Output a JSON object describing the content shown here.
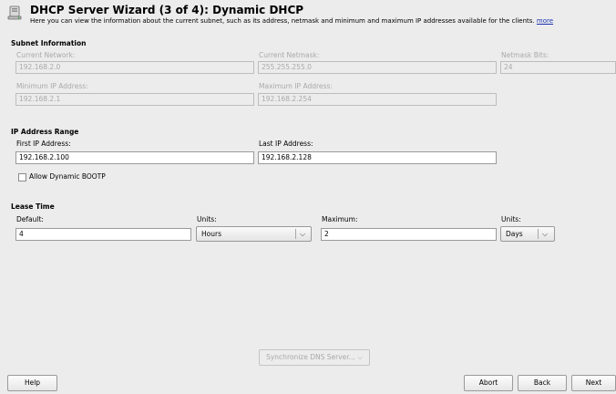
{
  "header": {
    "title": "DHCP Server Wizard (3 of 4): Dynamic DHCP",
    "description": "Here you can view the information about the current subnet, such as its address, netmask and minimum and maximum IP addresses available for the clients.",
    "more_link": "more",
    "icon": "dhcp-server-icon"
  },
  "subnet": {
    "heading": "Subnet Information",
    "current_network_label": "Current Network:",
    "current_network_value": "192.168.2.0",
    "current_netmask_label": "Current Netmask:",
    "current_netmask_value": "255.255.255.0",
    "netmask_bits_label": "Netmask Bits:",
    "netmask_bits_value": "24",
    "min_ip_label": "Minimum IP Address:",
    "min_ip_value": "192.168.2.1",
    "max_ip_label": "Maximum IP Address:",
    "max_ip_value": "192.168.2.254"
  },
  "ip_range": {
    "heading": "IP Address Range",
    "first_label": "First IP Address:",
    "first_value": "192.168.2.100",
    "last_label": "Last IP Address:",
    "last_value": "192.168.2.128",
    "bootp_label": "Allow Dynamic BOOTP",
    "bootp_checked": false
  },
  "lease": {
    "heading": "Lease Time",
    "default_label": "Default:",
    "default_value": "4",
    "default_units_label": "Units:",
    "default_units_value": "Hours",
    "maximum_label": "Maximum:",
    "maximum_value": "2",
    "maximum_units_label": "Units:",
    "maximum_units_value": "Days"
  },
  "buttons": {
    "sync_dns": "Synchronize DNS Server...",
    "help": "Help",
    "abort": "Abort",
    "back": "Back",
    "next": "Next"
  }
}
